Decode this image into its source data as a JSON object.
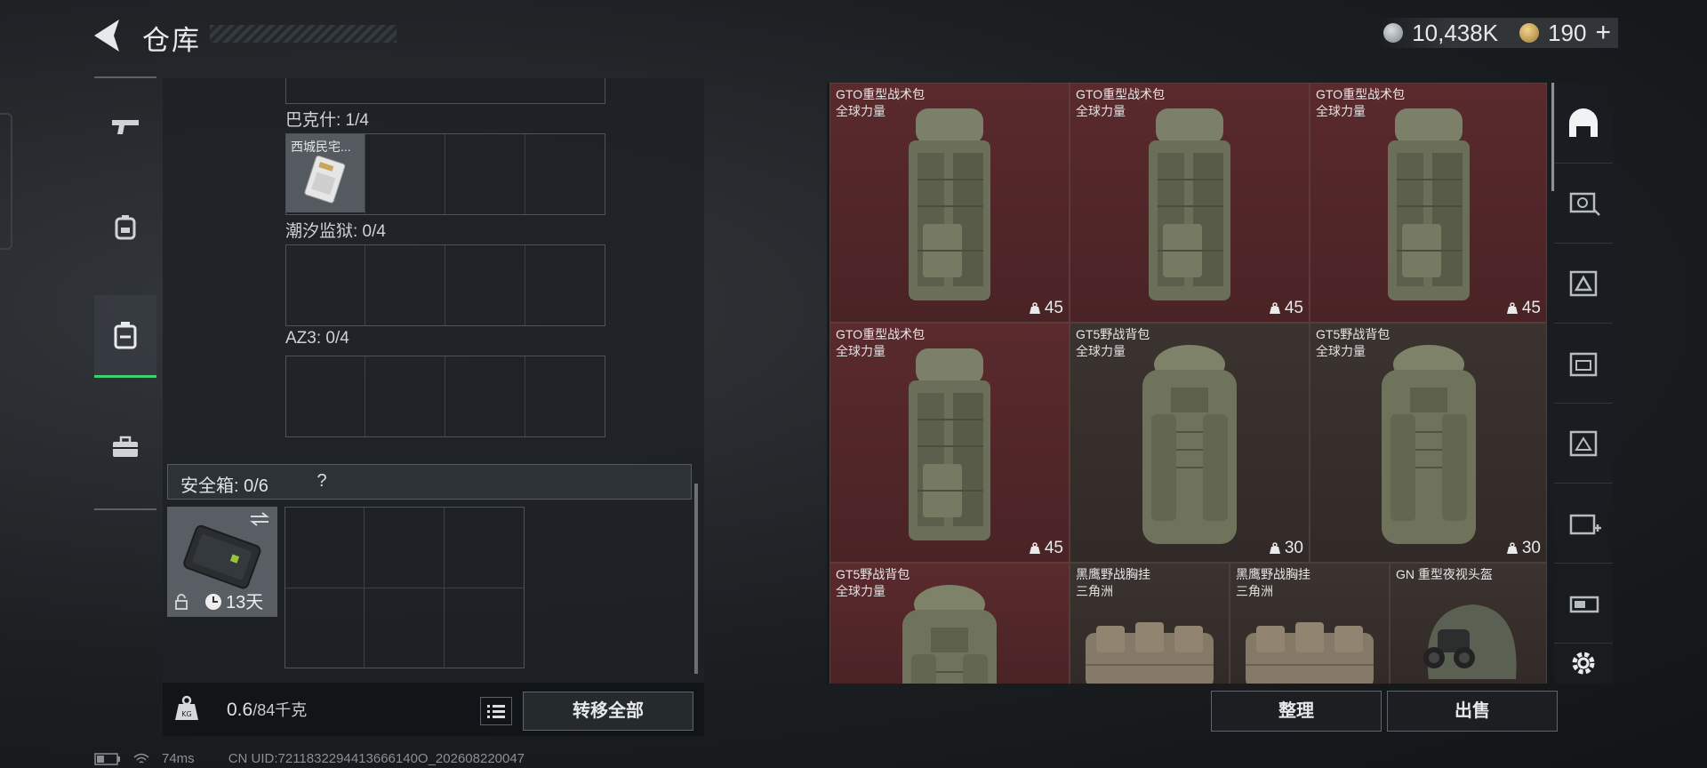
{
  "header": {
    "title": "仓库",
    "currency": [
      {
        "icon": "silver-coin-icon",
        "value": "10,438K",
        "color": "#9aa3ab"
      },
      {
        "icon": "gold-coin-icon",
        "value": "190",
        "color": "#c9a45a"
      }
    ],
    "add_label": "+"
  },
  "left": {
    "slots": [
      {
        "label": "巴克什: 1/4",
        "item": "西城民宅..."
      },
      {
        "label": "潮汐监狱: 0/4"
      },
      {
        "label": "AZ3: 0/4"
      }
    ],
    "safebox": {
      "label": "安全箱: 0/6",
      "help": "?",
      "timer": "13天"
    },
    "weight": {
      "current": "0.6",
      "capacity": "/84千克"
    },
    "transfer_label": "转移全部"
  },
  "status": {
    "ping": "74ms",
    "uid": "CN UID:7211832294413666140O_202608220047"
  },
  "inventory": {
    "items": [
      {
        "name": "GTO重型战术包",
        "sub": "全球力量",
        "count": "45",
        "kind": "tactical",
        "bg": "red"
      },
      {
        "name": "GTO重型战术包",
        "sub": "全球力量",
        "count": "45",
        "kind": "tactical",
        "bg": "red"
      },
      {
        "name": "GTO重型战术包",
        "sub": "全球力量",
        "count": "45",
        "kind": "tactical",
        "bg": "red"
      },
      {
        "name": "GTO重型战术包",
        "sub": "全球力量",
        "count": "45",
        "kind": "tactical",
        "bg": "red"
      },
      {
        "name": "GT5野战背包",
        "sub": "全球力量",
        "count": "30",
        "kind": "field",
        "bg": "brown"
      },
      {
        "name": "GT5野战背包",
        "sub": "全球力量",
        "count": "30",
        "kind": "field",
        "bg": "brown"
      },
      {
        "name": "GT5野战背包",
        "sub": "全球力量",
        "count": "",
        "kind": "field",
        "bg": "red"
      },
      {
        "name": "黑鹰野战胸挂",
        "sub": "三角洲",
        "count": "",
        "kind": "chest",
        "bg": "brown"
      },
      {
        "name": "黑鹰野战胸挂",
        "sub": "三角洲",
        "count": "",
        "kind": "chest",
        "bg": "brown"
      },
      {
        "name": "GN 重型夜视头盔",
        "sub": "",
        "count": "",
        "kind": "helmet",
        "bg": "brown"
      }
    ],
    "sort_label": "整理",
    "sell_label": "出售"
  },
  "right_tabs": [
    "helmet-tab-icon",
    "armor-tab-icon",
    "backpack-tab-icon",
    "chest-tab-icon",
    "container-tab-icon",
    "medkit-tab-icon",
    "misc-tab-icon"
  ],
  "left_tabs": [
    "pistol-tab-icon",
    "backpack-tab-icon",
    "container-tab-icon",
    "toolbox-tab-icon"
  ]
}
